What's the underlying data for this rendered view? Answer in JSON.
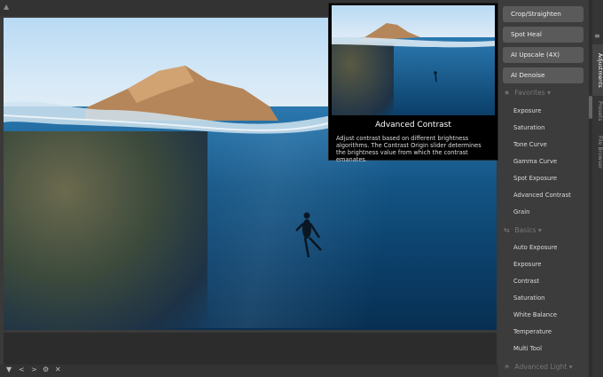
{
  "toolbar": {
    "collapse_icon": "triangle-up-icon"
  },
  "tooltip": {
    "title": "Advanced Contrast",
    "description": "Adjust contrast based on different brightness algorithms. The Contrast Origin slider determines the brightness value from which the contrast emanates."
  },
  "panel": {
    "buttons": [
      "Crop/Straighten",
      "Spot Heal",
      "AI Upscale (4X)",
      "AI Denoise"
    ],
    "favorites": {
      "label": "Favorites",
      "items": [
        "Exposure",
        "Saturation",
        "Tone Curve",
        "Gamma Curve",
        "Spot Exposure",
        "Advanced Contrast",
        "Grain"
      ]
    },
    "basics": {
      "label": "Basics",
      "items": [
        "Auto Exposure",
        "Exposure",
        "Contrast",
        "Saturation",
        "White Balance",
        "Temperature",
        "Multi Tool"
      ]
    },
    "advanced_light": {
      "label": "Advanced Light"
    }
  },
  "tabs": {
    "adjustments": "Adjustments",
    "presets": "Presets",
    "file_browser": "File Browser"
  },
  "bottombar": {
    "icons": [
      "triangle-down-icon",
      "chevron-left-icon",
      "chevron-right-icon",
      "settings-icon",
      "close-icon"
    ]
  }
}
